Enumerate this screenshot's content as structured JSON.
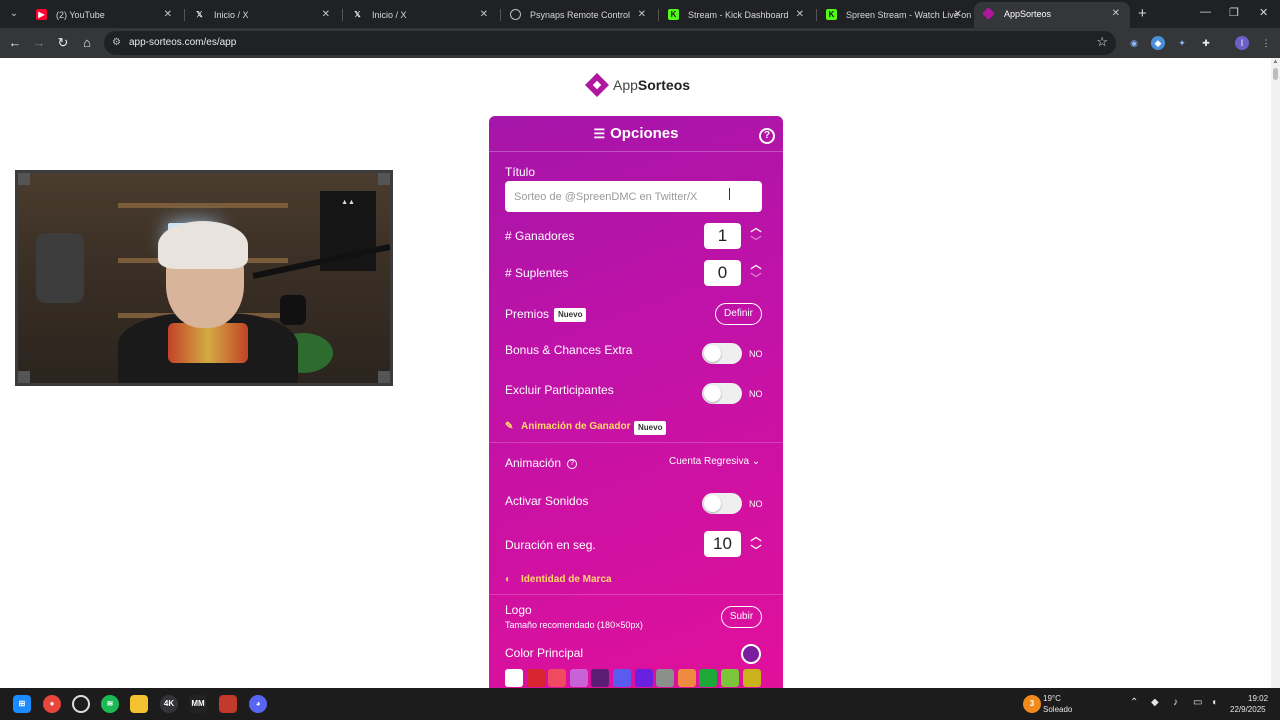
{
  "browser": {
    "tabs": [
      {
        "title": "(2) YouTube",
        "icon": "youtube-icon",
        "icon_color": "#ff0033",
        "active": false
      },
      {
        "title": "Inicio / X",
        "icon": "x-icon",
        "icon_color": "#e8eaed",
        "active": false
      },
      {
        "title": "Inicio / X",
        "icon": "x-icon",
        "icon_color": "#e8eaed",
        "active": false
      },
      {
        "title": "Psynaps Remote Control",
        "icon": "globe-icon",
        "icon_color": "#bdbdbd",
        "active": false
      },
      {
        "title": "Stream - Kick Dashboard",
        "icon": "kick-icon",
        "icon_color": "#53fc18",
        "active": false
      },
      {
        "title": "Spreen Stream - Watch Live on",
        "icon": "kick-icon",
        "icon_color": "#53fc18",
        "active": false
      },
      {
        "title": "AppSorteos",
        "icon": "appsorteos-icon",
        "icon_color": "#b0179f",
        "active": true
      }
    ],
    "url": "app-sorteos.com/es/app"
  },
  "brand": {
    "name_light": "App",
    "name_bold": "Sorteos",
    "color": "#b0179f"
  },
  "options": {
    "header": "Opciones",
    "title_label": "Título",
    "title_placeholder": "Sorteo de @SpreenDMC en Twitter/X",
    "winners_label": "# Ganadores",
    "winners_value": "1",
    "substitutes_label": "# Suplentes",
    "substitutes_value": "0",
    "prizes_label": "Premios",
    "new_badge": "Nuevo",
    "define_button": "Definir",
    "bonus_label": "Bonus & Chances Extra",
    "bonus_state": "NO",
    "exclude_label": "Excluir Participantes",
    "exclude_state": "NO",
    "winner_animation_section": "Animación de Ganador",
    "animation_label": "Animación",
    "animation_value": "Cuenta Regresiva",
    "sounds_label": "Activar Sonidos",
    "sounds_state": "NO",
    "duration_label": "Duración en seg.",
    "duration_value": "10",
    "brand_identity_section": "Identidad de Marca",
    "logo_label": "Logo",
    "logo_hint": "Tamaño recomendado (180×50px)",
    "upload_button": "Subir",
    "main_color_label": "Color Principal",
    "main_color": "#7a1e9e",
    "swatches": [
      "#ffffff",
      "#d9252f",
      "#ef4a5f",
      "#c763d6",
      "#5b1e74",
      "#5a5cf0",
      "#6a20e0",
      "#8a8f8c",
      "#f08a40",
      "#1fa83a",
      "#7cc43a",
      "#c9b21c"
    ]
  },
  "taskbar": {
    "weather_temp": "19°C",
    "weather_desc": "Soleado",
    "time": "19:02",
    "date": "22/9/2025",
    "weather_badge": "3"
  }
}
